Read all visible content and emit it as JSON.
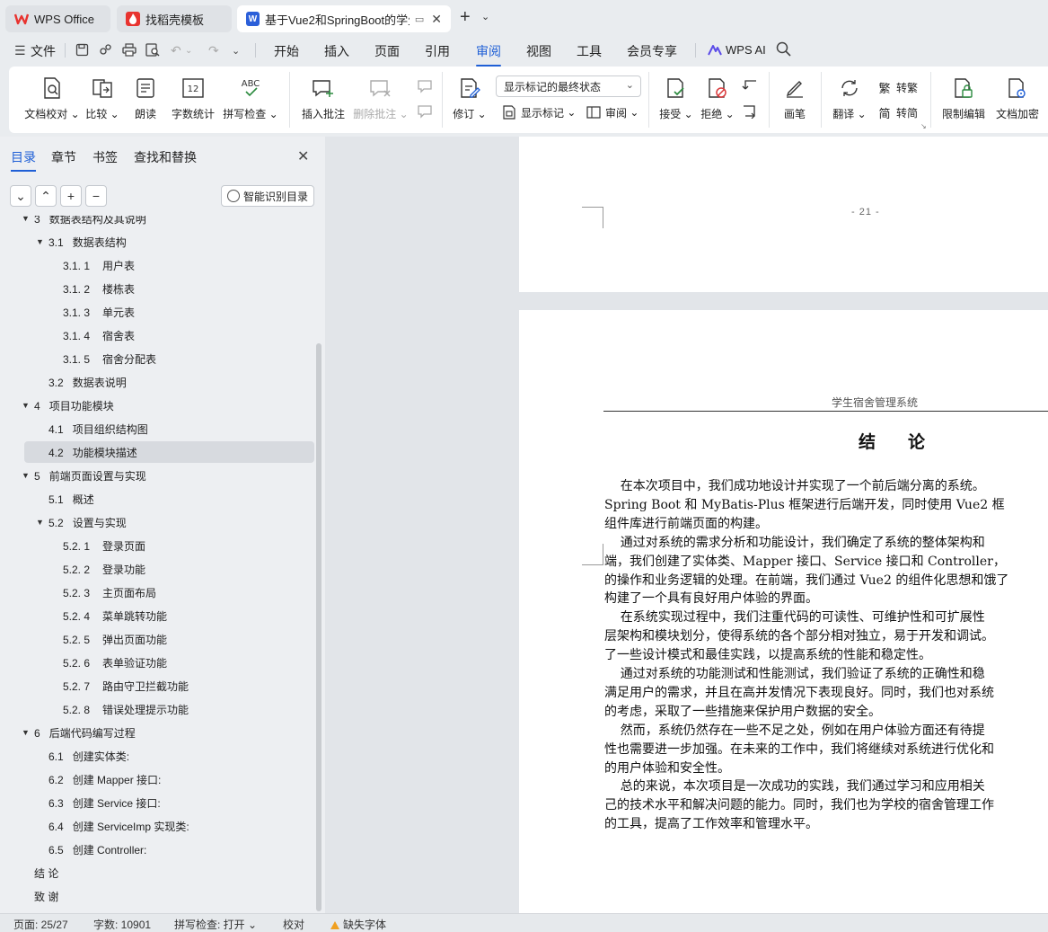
{
  "tabs": [
    {
      "label": "WPS Office",
      "icon": "wps-logo-icon",
      "color": "#e8332f"
    },
    {
      "label": "找稻壳模板",
      "icon": "docer-logo-icon",
      "color": "#e8332f"
    },
    {
      "label": "基于Vue2和SpringBoot的学生",
      "icon": "word-doc-icon",
      "color": "#2b5fd9"
    }
  ],
  "menu": {
    "file": "文件",
    "items": [
      "开始",
      "插入",
      "页面",
      "引用",
      "审阅",
      "视图",
      "工具",
      "会员专享"
    ],
    "active": "审阅",
    "wps_ai": "WPS AI"
  },
  "ribbon": {
    "doc_check": "文档校对",
    "compare": "比较",
    "read_aloud": "朗读",
    "word_count": "字数统计",
    "spell_check": "拼写检查",
    "insert_comment": "插入批注",
    "delete_comment": "删除批注",
    "track": "修订",
    "display_mode": "显示标记的最终状态",
    "show_markup": "显示标记",
    "review": "审阅",
    "accept": "接受",
    "reject": "拒绝",
    "pen": "画笔",
    "translate": "翻译",
    "to_traditional": "转繁",
    "to_simplified": "转简",
    "restrict_edit": "限制编辑",
    "encrypt": "文档加密"
  },
  "panel": {
    "tabs": [
      "目录",
      "章节",
      "书签",
      "查找和替换"
    ],
    "smart_toc": "智能识别目录",
    "toc": [
      {
        "num": "3",
        "text": "数据表结构及其说明",
        "level": 0,
        "expanded": true
      },
      {
        "num": "3.1",
        "text": "数据表结构",
        "level": 1,
        "expanded": true
      },
      {
        "num": "3.1. 1",
        "text": "用户表",
        "level": 2
      },
      {
        "num": "3.1. 2",
        "text": "楼栋表",
        "level": 2
      },
      {
        "num": "3.1. 3",
        "text": "单元表",
        "level": 2
      },
      {
        "num": "3.1. 4",
        "text": "宿舍表",
        "level": 2
      },
      {
        "num": "3.1. 5",
        "text": "宿舍分配表",
        "level": 2
      },
      {
        "num": "3.2",
        "text": "数据表说明",
        "level": 1
      },
      {
        "num": "4",
        "text": "项目功能模块",
        "level": 0,
        "expanded": true
      },
      {
        "num": "4.1",
        "text": "项目组织结构图",
        "level": 1
      },
      {
        "num": "4.2",
        "text": "功能模块描述",
        "level": 1,
        "selected": true
      },
      {
        "num": "5",
        "text": "前端页面设置与实现",
        "level": 0,
        "expanded": true
      },
      {
        "num": "5.1",
        "text": "概述",
        "level": 1
      },
      {
        "num": "5.2",
        "text": "设置与实现",
        "level": 1,
        "expanded": true
      },
      {
        "num": "5.2. 1",
        "text": "登录页面",
        "level": 2
      },
      {
        "num": "5.2. 2",
        "text": "登录功能",
        "level": 2
      },
      {
        "num": "5.2. 3",
        "text": "主页面布局",
        "level": 2
      },
      {
        "num": "5.2. 4",
        "text": "菜单跳转功能",
        "level": 2
      },
      {
        "num": "5.2. 5",
        "text": "弹出页面功能",
        "level": 2
      },
      {
        "num": "5.2. 6",
        "text": "表单验证功能",
        "level": 2
      },
      {
        "num": "5.2. 7",
        "text": "路由守卫拦截功能",
        "level": 2
      },
      {
        "num": "5.2. 8",
        "text": "错误处理提示功能",
        "level": 2
      },
      {
        "num": "6",
        "text": "后端代码编写过程",
        "level": 0,
        "expanded": true
      },
      {
        "num": "6.1",
        "text": "创建实体类:",
        "level": 1
      },
      {
        "num": "6.2",
        "text": "创建 Mapper 接口:",
        "level": 1
      },
      {
        "num": "6.3",
        "text": "创建 Service 接口:",
        "level": 1
      },
      {
        "num": "6.4",
        "text": "创建 ServiceImp 实现类:",
        "level": 1
      },
      {
        "num": "6.5",
        "text": "创建 Controller:",
        "level": 1
      },
      {
        "num": "",
        "text": "结    论",
        "level": 0
      },
      {
        "num": "",
        "text": "致    谢",
        "level": 0
      }
    ]
  },
  "document": {
    "page_number": "- 21 -",
    "header": "学生宿舍管理系统",
    "title": "结论",
    "lines": [
      "    在本次项目中，我们成功地设计并实现了一个前后端分离的系统。",
      "Spring Boot 和 MyBatis-Plus 框架进行后端开发，同时使用 Vue2 框",
      "组件库进行前端页面的构建。",
      "    通过对系统的需求分析和功能设计，我们确定了系统的整体架构和",
      "端，我们创建了实体类、Mapper 接口、Service 接口和 Controller，",
      "的操作和业务逻辑的处理。在前端，我们通过 Vue2 的组件化思想和饿了",
      "构建了一个具有良好用户体验的界面。",
      "    在系统实现过程中，我们注重代码的可读性、可维护性和可扩展性",
      "层架构和模块划分，使得系统的各个部分相对独立，易于开发和调试。",
      "了一些设计模式和最佳实践，以提高系统的性能和稳定性。",
      "    通过对系统的功能测试和性能测试，我们验证了系统的正确性和稳",
      "满足用户的需求，并且在高并发情况下表现良好。同时，我们也对系统",
      "的考虑，采取了一些措施来保护用户数据的安全。",
      "    然而，系统仍然存在一些不足之处，例如在用户体验方面还有待提",
      "性也需要进一步加强。在未来的工作中，我们将继续对系统进行优化和",
      "的用户体验和安全性。",
      "    总的来说，本次项目是一次成功的实践，我们通过学习和应用相关",
      "己的技术水平和解决问题的能力。同时，我们也为学校的宿舍管理工作",
      "的工具，提高了工作效率和管理水平。"
    ]
  },
  "status": {
    "page": "页面: 25/27",
    "words": "字数: 10901",
    "spell": "拼写检查: 打开",
    "proof": "校对",
    "missing_font": "缺失字体"
  },
  "colors": {
    "accent": "#1f5fd6",
    "warning": "#f0a020"
  }
}
